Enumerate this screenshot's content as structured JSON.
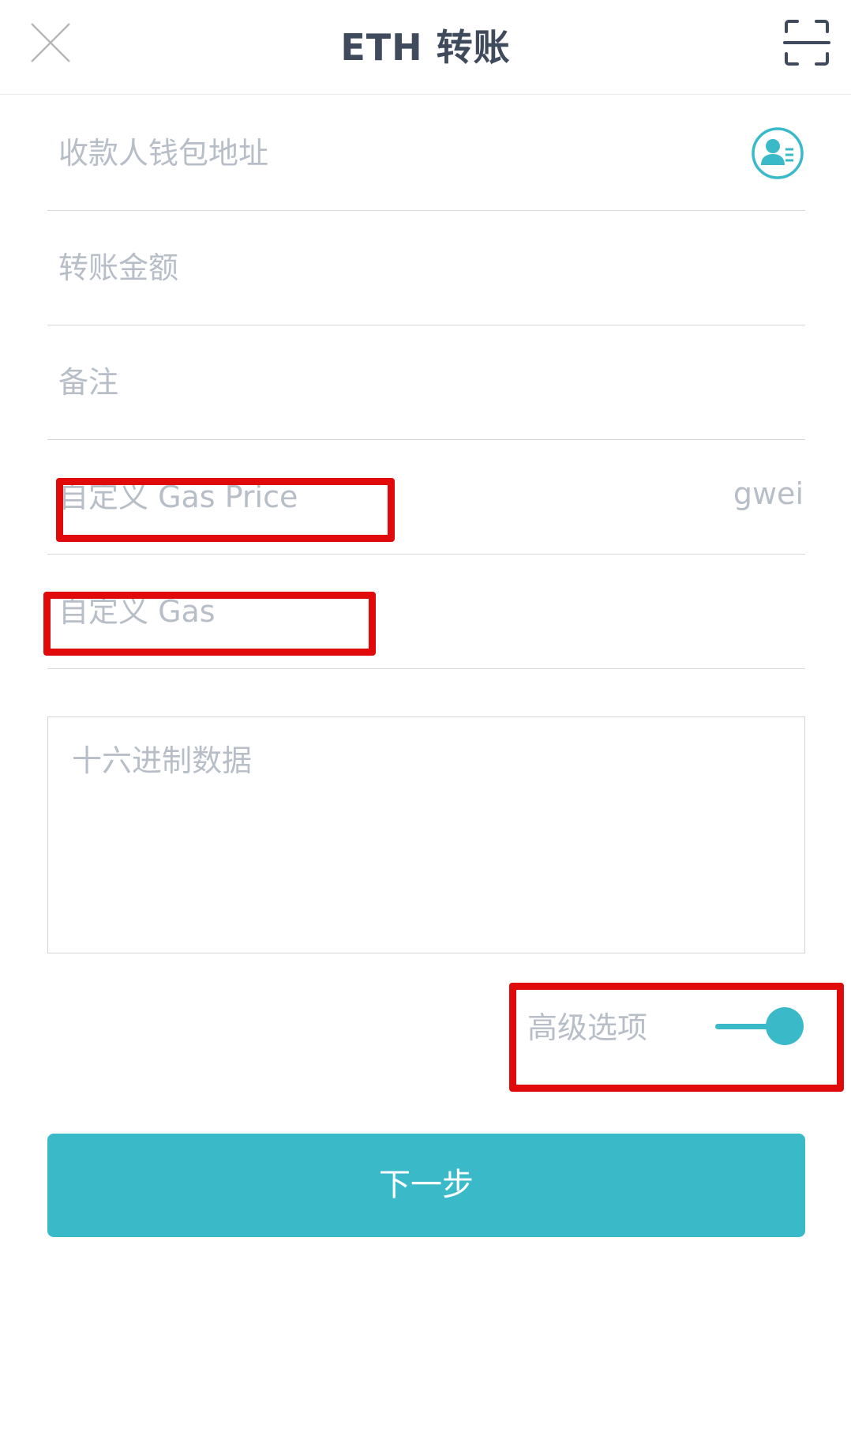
{
  "header": {
    "title": "ETH 转账",
    "close_icon": "close-icon",
    "scan_icon": "scan-icon"
  },
  "form": {
    "recipient_placeholder": "收款人钱包地址",
    "recipient_value": "",
    "contact_icon": "contact-book-icon",
    "amount_placeholder": "转账金额",
    "amount_value": "",
    "memo_placeholder": "备注",
    "memo_value": "",
    "gas_price_placeholder": "自定义 Gas Price",
    "gas_price_value": "",
    "gas_price_unit": "gwei",
    "gas_placeholder": "自定义 Gas",
    "gas_value": "",
    "hex_placeholder": "十六进制数据",
    "hex_value": ""
  },
  "advanced": {
    "label": "高级选项",
    "enabled": true
  },
  "next_button": {
    "label": "下一步"
  },
  "colors": {
    "accent": "#3ab9c9",
    "title": "#3f4a5c",
    "placeholder": "#b7bec8",
    "divider": "#d8d8d8",
    "highlight": "#e00a0a"
  }
}
